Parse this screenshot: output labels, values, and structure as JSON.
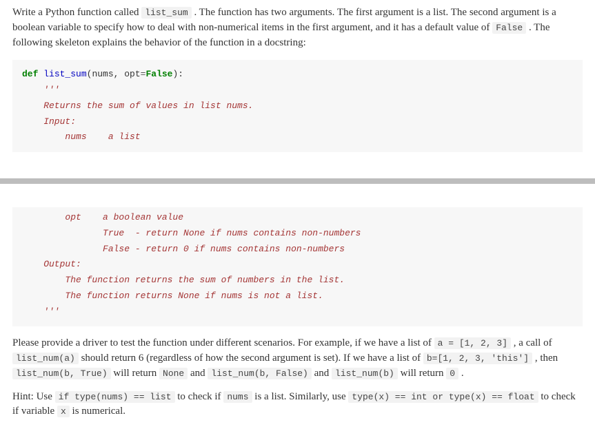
{
  "intro": {
    "t1": "Write a Python function called ",
    "c1": "list_sum",
    "t2": " . The function has two arguments. The first argument is a list. The second argument is a boolean variable to specify how to deal with non-numerical items in the first argument, and it has a default value of ",
    "c2": "False",
    "t3": " . The following skeleton explains the behavior of the function in a docstring:"
  },
  "code1": {
    "l1a": "def ",
    "l1b": "list_sum",
    "l1c": "(nums, opt",
    "l1d": "=",
    "l1e": "False",
    "l1f": "):",
    "l2": "    '''",
    "l3": "    Returns the sum of values in list nums.",
    "l4": "    Input:",
    "l5": "        nums    a list"
  },
  "code2": {
    "l1": "        opt    a boolean value",
    "l2": "               True  - return None if nums contains non-numbers",
    "l3": "               False - return 0 if nums contains non-numbers",
    "l4": "    Output:",
    "l5": "        The function returns the sum of numbers in the list.",
    "l6": "        The function returns None if nums is not a list.",
    "l7": "    '''"
  },
  "closing": {
    "t1": "Please provide a driver to test the function under different scenarios. For example, if we have a list of ",
    "c1": "a = [1, 2, 3]",
    "t2": " , a call of ",
    "c2": "list_num(a)",
    "t3": " should return 6 (regardless of how the second argument is set). If we have a list of ",
    "c3": "b=[1, 2, 3, 'this']",
    "t4": " , then ",
    "c4": "list_num(b, True)",
    "t5": " will return ",
    "c5": "None",
    "t6": " and ",
    "c6": "list_num(b, False)",
    "t7": " and ",
    "c7": "list_num(b)",
    "t8": " will return ",
    "c8": "0",
    "t9": " ."
  },
  "hint": {
    "t1": "Hint: Use ",
    "c1": "if type(nums) == list",
    "t2": " to check if ",
    "c2": "nums",
    "t3": " is a list. Similarly, use ",
    "c3": "type(x) == int or type(x) == float",
    "t4": " to check if variable ",
    "c4": "x",
    "t5": " is numerical."
  }
}
